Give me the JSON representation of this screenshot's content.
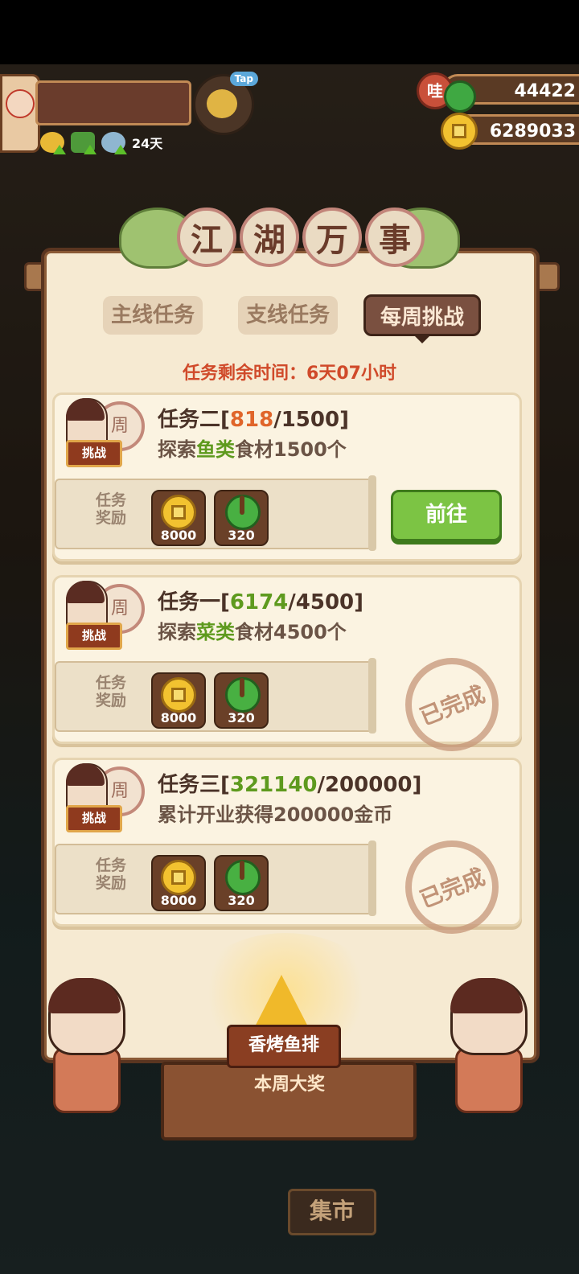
{
  "hud": {
    "days": "24天",
    "wa_label": "哇",
    "jade_amount": "44422",
    "coin_amount": "6289033",
    "tap_label": "Tap"
  },
  "panel": {
    "title_chars": [
      "江",
      "湖",
      "万",
      "事"
    ],
    "tabs": [
      {
        "label": "主线任务",
        "active": false
      },
      {
        "label": "支线任务",
        "active": false
      },
      {
        "label": "每周挑战",
        "active": true
      }
    ],
    "remaining_time": "任务剩余时间：6天07小时"
  },
  "tasks": [
    {
      "name": "任务二",
      "progress_current": "818",
      "progress_total": "1500",
      "desc_prefix": "探索",
      "desc_highlight": "鱼类",
      "desc_suffix": "食材1500个",
      "badge": "挑战",
      "drum": "周",
      "reward_label": "任务奖励",
      "coin_reward": "8000",
      "jade_reward": "320",
      "action": "前往",
      "status": "in_progress"
    },
    {
      "name": "任务一",
      "progress_current": "6174",
      "progress_total": "4500",
      "desc_prefix": "探索",
      "desc_highlight": "菜类",
      "desc_suffix": "食材4500个",
      "badge": "挑战",
      "drum": "周",
      "reward_label": "任务奖励",
      "coin_reward": "8000",
      "jade_reward": "320",
      "stamp": "已完成",
      "status": "completed"
    },
    {
      "name": "任务三",
      "progress_current": "321140",
      "progress_total": "200000",
      "desc_prefix": "累计开业获得200000金币",
      "desc_highlight": "",
      "desc_suffix": "",
      "badge": "挑战",
      "drum": "周",
      "reward_label": "任务奖励",
      "coin_reward": "8000",
      "jade_reward": "320",
      "stamp": "已完成",
      "status": "completed"
    }
  ],
  "prize": {
    "name": "香烤鱼排",
    "subtitle": "本周大奖"
  },
  "market_label": "集市",
  "colors": {
    "accent_red": "#d04a2a",
    "progress_orange": "#e0652a",
    "progress_green": "#5e9a1e",
    "go_button": "#7cc444"
  }
}
